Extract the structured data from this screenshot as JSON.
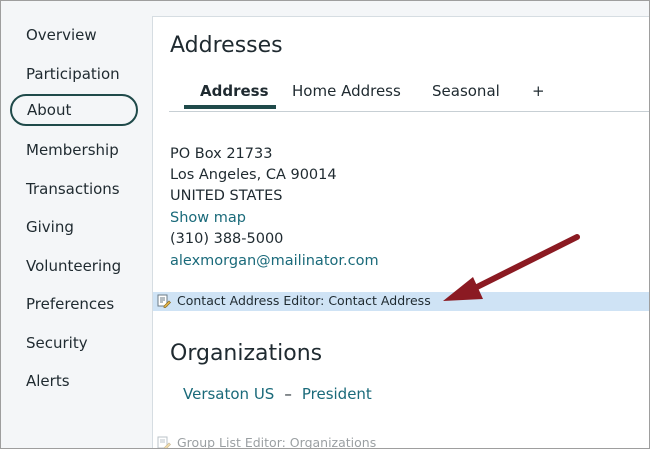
{
  "sidebar": {
    "items": [
      {
        "label": "Overview"
      },
      {
        "label": "Participation"
      },
      {
        "label": "About",
        "active": true
      },
      {
        "label": "Membership"
      },
      {
        "label": "Transactions"
      },
      {
        "label": "Giving"
      },
      {
        "label": "Volunteering"
      },
      {
        "label": "Preferences"
      },
      {
        "label": "Security"
      },
      {
        "label": "Alerts"
      }
    ]
  },
  "addresses": {
    "title": "Addresses",
    "tabs": [
      {
        "label": "Address",
        "active": true
      },
      {
        "label": "Home Address"
      },
      {
        "label": "Seasonal"
      },
      {
        "label": "+"
      }
    ],
    "lines": {
      "street": "PO Box 21733",
      "city": "Los Angeles, CA 90014",
      "country": "UNITED STATES",
      "map_link": "Show map",
      "phone": "(310) 388-5000",
      "email": "alexmorgan@mailinator.com"
    },
    "editor_label": "Contact Address Editor: Contact Address"
  },
  "organizations": {
    "title": "Organizations",
    "org_name": "Versaton US",
    "separator": "–",
    "role": "President",
    "editor_label": "Group List Editor: Organizations"
  },
  "colors": {
    "accent": "#1f4a4a",
    "link": "#1a6a7a",
    "editor_highlight": "#cfe3f5",
    "annotation_arrow": "#8b1a22"
  },
  "icons": {
    "editor": "edit-page-icon",
    "annotation": "red-arrow-icon"
  }
}
